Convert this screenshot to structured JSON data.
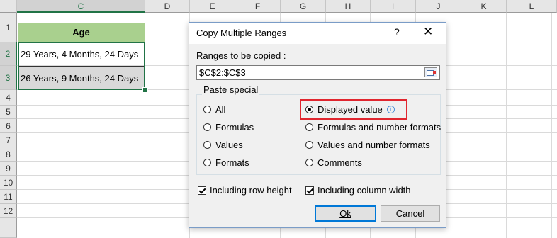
{
  "sheet": {
    "columns": [
      "C",
      "D",
      "E",
      "F",
      "G",
      "H",
      "I",
      "J",
      "K",
      "L"
    ],
    "rows": [
      "1",
      "2",
      "3",
      "4",
      "5",
      "6",
      "7",
      "8",
      "9",
      "10",
      "11",
      "12"
    ],
    "cells": {
      "c1": "Age",
      "c2": "29 Years, 4 Months, 24 Days",
      "c3": "26 Years, 9 Months, 24 Days"
    },
    "colors": {
      "header_green": "#a9d08e",
      "selection": "#217346",
      "cell_gray": "#d9d9d9"
    }
  },
  "dialog": {
    "title": "Copy Multiple Ranges",
    "help": "?",
    "close": "✕",
    "ranges_label": "Ranges to be copied :",
    "ranges_value": "$C$2:$C$3",
    "paste_special_label": "Paste special",
    "options": [
      {
        "label": "All",
        "checked": false
      },
      {
        "label": "Displayed value",
        "checked": true
      },
      {
        "label": "Formulas",
        "checked": false
      },
      {
        "label": "Formulas and number formats",
        "checked": false
      },
      {
        "label": "Values",
        "checked": false
      },
      {
        "label": "Values and number formats",
        "checked": false
      },
      {
        "label": "Formats",
        "checked": false
      },
      {
        "label": "Comments",
        "checked": false
      }
    ],
    "include_row_height": "Including row height",
    "include_column_width": "Including column width",
    "ok_label": "Ok",
    "cancel_label": "Cancel",
    "highlight_color": "#e0262f"
  }
}
